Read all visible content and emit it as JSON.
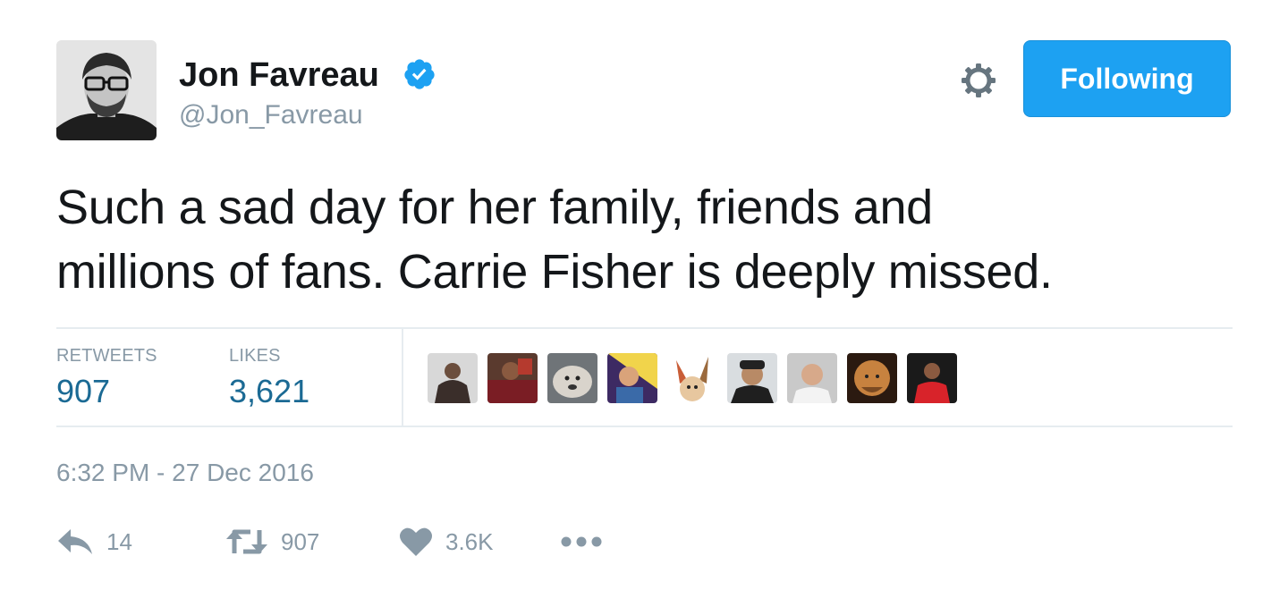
{
  "user": {
    "display_name": "Jon Favreau",
    "handle": "@Jon_Favreau",
    "verified": true
  },
  "header": {
    "follow_button_label": "Following"
  },
  "tweet": {
    "text_lines": [
      "Such a sad day for her family, friends and",
      "millions of fans. Carrie Fisher is deeply missed."
    ],
    "timestamp": "6:32 PM - 27 Dec 2016"
  },
  "stats": {
    "retweets_label": "RETWEETS",
    "retweets_value": "907",
    "likes_label": "LIKES",
    "likes_value": "3,621"
  },
  "actions": {
    "reply_count": "14",
    "retweet_count": "907",
    "like_count": "3.6K"
  },
  "colors": {
    "accent": "#1da1f2",
    "stat_value": "#1b6a94",
    "muted": "#8899a6",
    "text": "#14171a",
    "divider": "#e6ecf0"
  },
  "icons": {
    "verified": "verified-badge-icon",
    "settings": "gear-icon",
    "reply": "reply-icon",
    "retweet": "retweet-icon",
    "like": "heart-icon",
    "more": "more-dots-icon"
  }
}
